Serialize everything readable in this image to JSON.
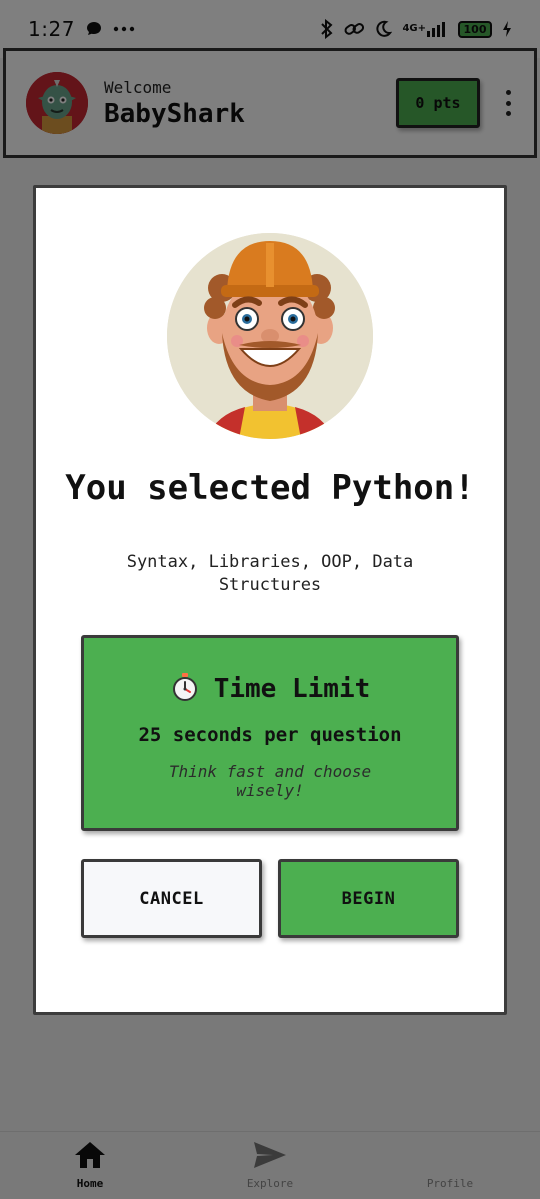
{
  "status_bar": {
    "time": "1:27",
    "network_label": "4G+",
    "battery": "100"
  },
  "header": {
    "welcome_label": "Welcome",
    "user_name": "BabyShark",
    "points_label": "0 pts"
  },
  "modal": {
    "title": "You selected Python!",
    "subtitle": "Syntax, Libraries, OOP, Data Structures",
    "time_limit": {
      "icon": "stopwatch-icon",
      "title": "Time Limit",
      "detail": "25 seconds per question",
      "hint": "Think fast and choose wisely!"
    },
    "cancel_label": "CANCEL",
    "begin_label": "BEGIN"
  },
  "bottom_nav": {
    "items": [
      {
        "label": "Home",
        "icon": "home-icon"
      },
      {
        "label": "Explore",
        "icon": "send-icon"
      },
      {
        "label": "Profile",
        "icon": "profile-icon"
      }
    ]
  },
  "colors": {
    "accent_green": "#4caf50",
    "avatar_red": "#c62832",
    "overlay": "rgba(0,0,0,0.5)"
  }
}
